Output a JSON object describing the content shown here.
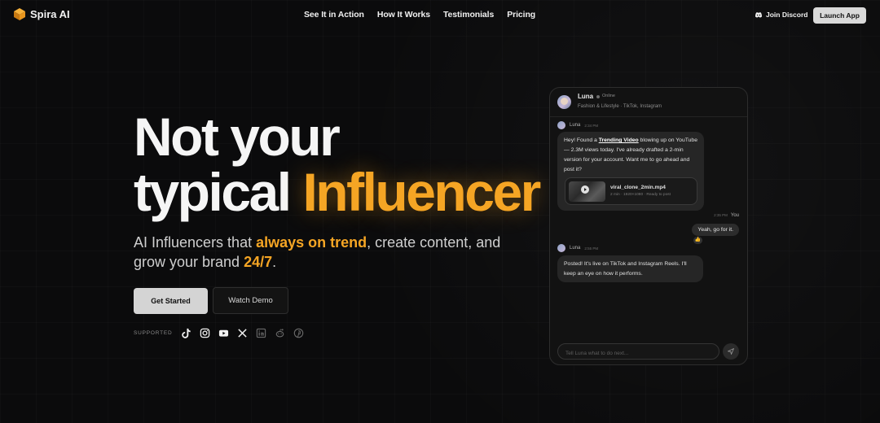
{
  "brand": {
    "name": "Spira AI",
    "accent_color": "#f5a524"
  },
  "nav": {
    "links": [
      "See It in Action",
      "How It Works",
      "Testimonials",
      "Pricing"
    ],
    "discord_label": "Join Discord",
    "launch_label": "Launch App"
  },
  "hero": {
    "title_line1": "Not your",
    "title_line2_plain": "typical ",
    "title_line2_accent": "Influencer",
    "subtitle_part1": "AI Influencers that ",
    "subtitle_hl1": "always on trend",
    "subtitle_part2": ", create content, and grow your brand ",
    "subtitle_hl2": "24/7",
    "subtitle_part3": ".",
    "primary_cta": "Get Started",
    "secondary_cta": "Watch Demo",
    "supported_label": "SUPPORTED",
    "platforms": [
      "tiktok-icon",
      "instagram-icon",
      "youtube-icon",
      "x-icon",
      "linkedin-icon",
      "reddit-icon",
      "pinterest-icon"
    ]
  },
  "chat": {
    "agent_name": "Luna",
    "status": "Online",
    "description": "Fashion & Lifestyle · TikTok, Instagram",
    "msg1": {
      "sender": "Luna",
      "time": "2:34 PM",
      "text_before": "Hey! Found a ",
      "link": "Trending Video",
      "text_after": " blowing up on YouTube — 2.3M views today. I've already drafted a 2-min version for your account. Want me to go ahead and post it?",
      "attachment_name": "viral_clone_2min.mp4",
      "attachment_meta": "2 min · 1920×1080 · Ready to post"
    },
    "user_msg": {
      "time": "2:35 PM",
      "sender": "You",
      "text": "Yeah, go for it.",
      "reaction": "👍"
    },
    "msg2": {
      "sender": "Luna",
      "time": "2:55 PM",
      "text": "Posted! It's live on TikTok and Instagram Reels. I'll keep an eye on how it performs."
    },
    "input_placeholder": "Tell Luna what to do next..."
  }
}
